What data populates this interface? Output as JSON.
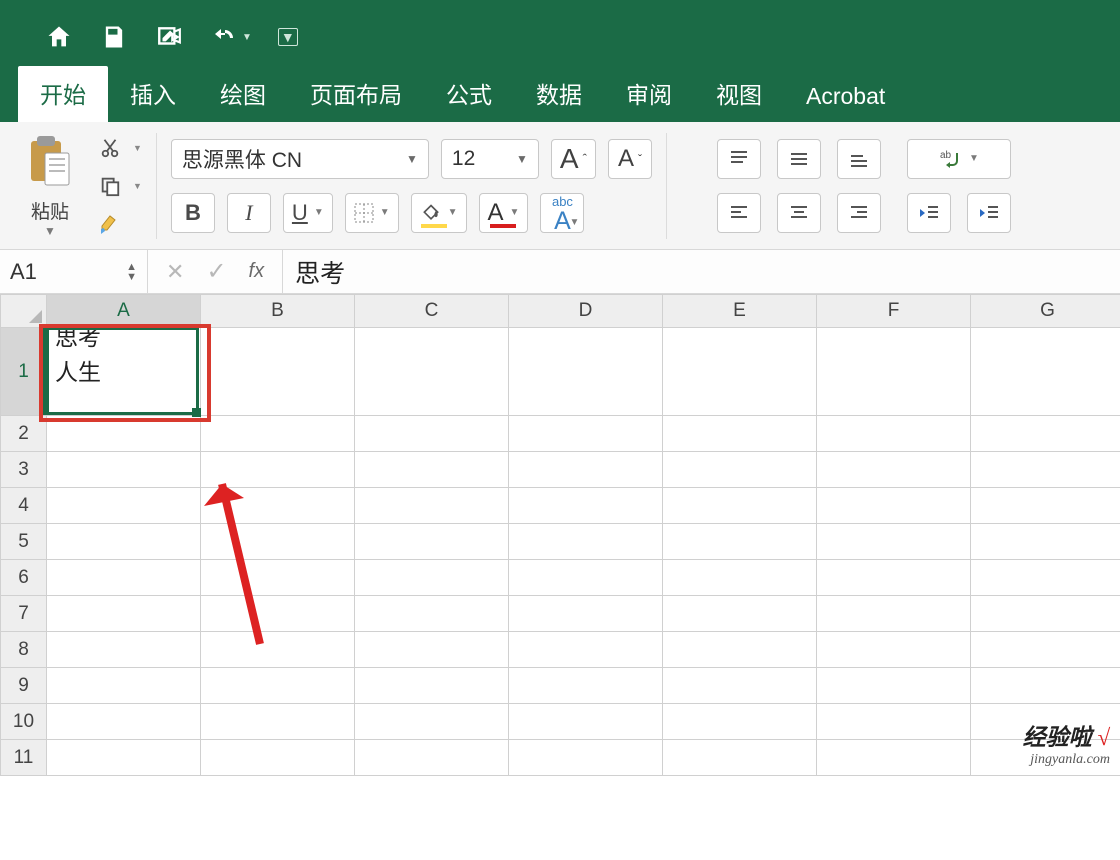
{
  "qat": {
    "icons": [
      "home-icon",
      "save-icon",
      "edit-icon",
      "undo-icon",
      "customize-icon"
    ]
  },
  "tabs": [
    {
      "label": "开始",
      "active": true
    },
    {
      "label": "插入",
      "active": false
    },
    {
      "label": "绘图",
      "active": false
    },
    {
      "label": "页面布局",
      "active": false
    },
    {
      "label": "公式",
      "active": false
    },
    {
      "label": "数据",
      "active": false
    },
    {
      "label": "审阅",
      "active": false
    },
    {
      "label": "视图",
      "active": false
    },
    {
      "label": "Acrobat",
      "active": false
    }
  ],
  "ribbon": {
    "paste_label": "粘贴",
    "font_name": "思源黑体 CN",
    "font_size": "12",
    "bold": "B",
    "italic": "I",
    "underline": "U",
    "cell_style_small": "abc",
    "cell_style_big": "A"
  },
  "namebox": "A1",
  "formula_fx": "fx",
  "formula_value": "思考",
  "columns": [
    "A",
    "B",
    "C",
    "D",
    "E",
    "F",
    "G"
  ],
  "rows": [
    "1",
    "2",
    "3",
    "4",
    "5",
    "6",
    "7",
    "8",
    "9",
    "10",
    "11"
  ],
  "selected_col": "A",
  "selected_row": "1",
  "cells": {
    "A1": "思考\n人生"
  },
  "watermark": {
    "line1_a": "经验啦",
    "line1_b": "√",
    "line2": "jingyanla.com"
  }
}
